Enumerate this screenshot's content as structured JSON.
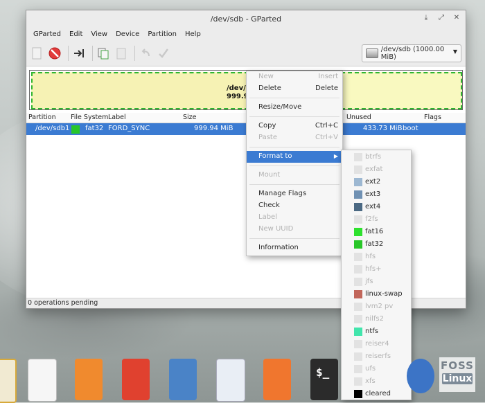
{
  "window": {
    "title": "/dev/sdb - GParted"
  },
  "menubar": [
    "GParted",
    "Edit",
    "View",
    "Device",
    "Partition",
    "Help"
  ],
  "device_selector": {
    "label": "/dev/sdb  (1000.00 MiB)"
  },
  "graph": {
    "line1": "/dev/sb",
    "line2": "999.9"
  },
  "table": {
    "headers": {
      "partition": "Partition",
      "filesystem": "File System",
      "label": "Label",
      "size": "Size",
      "unused": "Unused",
      "flags": "Flags"
    },
    "rows": [
      {
        "partition": "/dev/sdb1",
        "filesystem": "fat32",
        "fs_color": "#28c628",
        "label": "FORD_SYNC",
        "size": "999.94 MiB",
        "unused": "433.73 MiB",
        "flags": "boot"
      }
    ]
  },
  "status": "0 operations pending",
  "context_menu": {
    "new": {
      "label": "New",
      "shortcut": "Insert"
    },
    "delete": {
      "label": "Delete",
      "shortcut": "Delete"
    },
    "resize": {
      "label": "Resize/Move"
    },
    "copy": {
      "label": "Copy",
      "shortcut": "Ctrl+C"
    },
    "paste": {
      "label": "Paste",
      "shortcut": "Ctrl+V"
    },
    "format": {
      "label": "Format to"
    },
    "mount": {
      "label": "Mount"
    },
    "manage_flags": {
      "label": "Manage Flags"
    },
    "check": {
      "label": "Check"
    },
    "label": {
      "label": "Label"
    },
    "new_uuid": {
      "label": "New UUID"
    },
    "information": {
      "label": "Information"
    }
  },
  "format_submenu": [
    {
      "name": "btrfs",
      "color": "#e2e2e2",
      "enabled": false
    },
    {
      "name": "exfat",
      "color": "#e2e2e2",
      "enabled": false
    },
    {
      "name": "ext2",
      "color": "#9db8d2",
      "enabled": true
    },
    {
      "name": "ext3",
      "color": "#7091b3",
      "enabled": true
    },
    {
      "name": "ext4",
      "color": "#4b6983",
      "enabled": true
    },
    {
      "name": "f2fs",
      "color": "#e2e2e2",
      "enabled": false
    },
    {
      "name": "fat16",
      "color": "#2ee12e",
      "enabled": true
    },
    {
      "name": "fat32",
      "color": "#28c628",
      "enabled": true
    },
    {
      "name": "hfs",
      "color": "#e2e2e2",
      "enabled": false
    },
    {
      "name": "hfs+",
      "color": "#e2e2e2",
      "enabled": false
    },
    {
      "name": "jfs",
      "color": "#e2e2e2",
      "enabled": false
    },
    {
      "name": "linux-swap",
      "color": "#c1665a",
      "enabled": true
    },
    {
      "name": "lvm2 pv",
      "color": "#e2e2e2",
      "enabled": false
    },
    {
      "name": "nilfs2",
      "color": "#e2e2e2",
      "enabled": false
    },
    {
      "name": "ntfs",
      "color": "#42e5ac",
      "enabled": true
    },
    {
      "name": "reiser4",
      "color": "#e2e2e2",
      "enabled": false
    },
    {
      "name": "reiserfs",
      "color": "#e2e2e2",
      "enabled": false
    },
    {
      "name": "ufs",
      "color": "#e2e2e2",
      "enabled": false
    },
    {
      "name": "xfs",
      "color": "#e2e2e2",
      "enabled": false
    },
    {
      "name": "cleared",
      "color": "#000000",
      "enabled": true
    }
  ],
  "dock": [
    {
      "icon": "file-manager-icon"
    },
    {
      "icon": "calendar-icon"
    },
    {
      "icon": "music-player-icon"
    },
    {
      "icon": "video-player-icon"
    },
    {
      "icon": "photos-icon"
    },
    {
      "icon": "settings-toggle-icon"
    },
    {
      "icon": "app-center-icon"
    },
    {
      "icon": "terminal-icon",
      "text": "$_"
    },
    {
      "icon": "browser-icon"
    }
  ],
  "watermark": {
    "line1": "FOSS",
    "line2": "Linux"
  }
}
